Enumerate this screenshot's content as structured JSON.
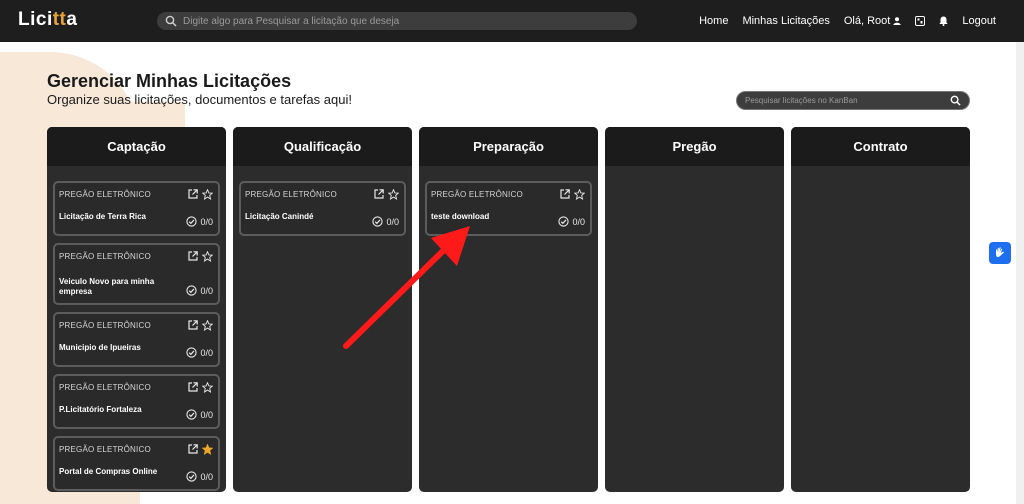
{
  "app": {
    "logo_main": "Lici",
    "logo_accent": "tt",
    "logo_end": "a"
  },
  "topbar": {
    "search_placeholder": "Digite algo para Pesquisar a licitação que deseja",
    "nav_home": "Home",
    "nav_minhas": "Minhas Licitações",
    "nav_user": "Olá, Root",
    "nav_logout": "Logout"
  },
  "page": {
    "title": "Gerenciar Minhas Licitações",
    "subtitle": "Organize suas licitações, documentos e tarefas aqui!",
    "kanban_search_placeholder": "Pesquisar licitações no KanBan"
  },
  "columns": [
    {
      "title": "Captação",
      "cards": [
        {
          "type": "PREGÃO ELETRÔNICO",
          "title": "Licitação de Terra Rica",
          "count": "0/0",
          "starred": false
        },
        {
          "type": "PREGÃO ELETRÔNICO",
          "title": "Veiculo Novo para minha empresa",
          "count": "0/0",
          "starred": false
        },
        {
          "type": "PREGÃO ELETRÔNICO",
          "title": "Municipio de Ipueiras",
          "count": "0/0",
          "starred": false
        },
        {
          "type": "PREGÃO ELETRÔNICO",
          "title": "P.Licitatório Fortaleza",
          "count": "0/0",
          "starred": false
        },
        {
          "type": "PREGÃO ELETRÔNICO",
          "title": "Portal de Compras Online",
          "count": "0/0",
          "starred": true
        }
      ]
    },
    {
      "title": "Qualificação",
      "cards": [
        {
          "type": "PREGÃO ELETRÔNICO",
          "title": "Licitação Canindé",
          "count": "0/0",
          "starred": false
        }
      ]
    },
    {
      "title": "Preparação",
      "cards": [
        {
          "type": "PREGÃO ELETRÔNICO",
          "title": "teste download",
          "count": "0/0",
          "starred": false
        }
      ]
    },
    {
      "title": "Pregão",
      "cards": []
    },
    {
      "title": "Contrato",
      "cards": []
    }
  ],
  "colors": {
    "topbar": "#1e1e1e",
    "column_bg": "#2c2c2c",
    "column_head": "#1b1b1b",
    "star_active": "#f0a62b",
    "arrow": "#ff1a1a",
    "a11y": "#1e6ff0"
  }
}
